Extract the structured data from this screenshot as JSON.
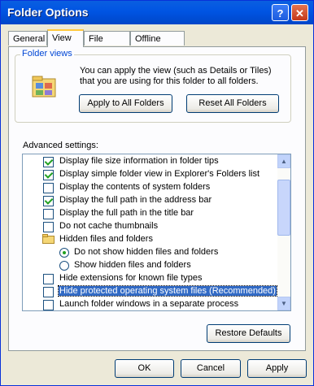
{
  "window": {
    "title": "Folder Options"
  },
  "titlebar": {
    "help_label": "?",
    "close_label": "✕"
  },
  "tabs": [
    {
      "label": "General"
    },
    {
      "label": "View"
    },
    {
      "label": "File Types"
    },
    {
      "label": "Offline Files"
    }
  ],
  "folder_views": {
    "legend": "Folder views",
    "description": "You can apply the view (such as Details or Tiles) that you are using for this folder to all folders.",
    "apply_button": "Apply to All Folders",
    "reset_button": "Reset All Folders"
  },
  "advanced": {
    "label": "Advanced settings:",
    "items": [
      {
        "type": "checkbox",
        "label": "Display file size information in folder tips",
        "checked": true
      },
      {
        "type": "checkbox",
        "label": "Display simple folder view in Explorer's Folders list",
        "checked": true
      },
      {
        "type": "checkbox",
        "label": "Display the contents of system folders",
        "checked": false
      },
      {
        "type": "checkbox",
        "label": "Display the full path in the address bar",
        "checked": true
      },
      {
        "type": "checkbox",
        "label": "Display the full path in the title bar",
        "checked": false
      },
      {
        "type": "checkbox",
        "label": "Do not cache thumbnails",
        "checked": false
      },
      {
        "type": "folder",
        "label": "Hidden files and folders"
      },
      {
        "type": "radio",
        "label": "Do not show hidden files and folders",
        "selected": true
      },
      {
        "type": "radio",
        "label": "Show hidden files and folders",
        "selected": false
      },
      {
        "type": "checkbox",
        "label": "Hide extensions for known file types",
        "checked": false
      },
      {
        "type": "checkbox",
        "label": "Hide protected operating system files (Recommended)",
        "checked": false,
        "highlighted": true
      },
      {
        "type": "checkbox",
        "label": "Launch folder windows in a separate process",
        "checked": false
      }
    ]
  },
  "restore_button": "Restore Defaults",
  "footer": {
    "ok": "OK",
    "cancel": "Cancel",
    "apply": "Apply"
  },
  "colors": {
    "titlebar": "#0054e3",
    "selection": "#316ac5",
    "check": "#21a121"
  }
}
